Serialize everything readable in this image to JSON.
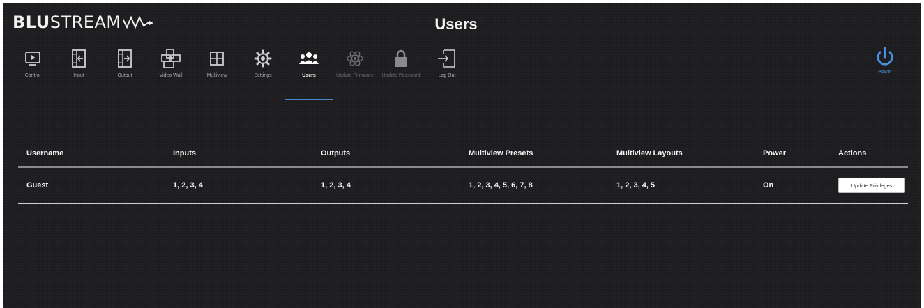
{
  "app": {
    "logo_bold": "BLU",
    "logo_rest": "STREAM"
  },
  "header": {
    "title": "Users"
  },
  "nav": {
    "items": [
      {
        "label": "Control",
        "icon": "control-icon"
      },
      {
        "label": "Input",
        "icon": "input-icon"
      },
      {
        "label": "Output",
        "icon": "output-icon"
      },
      {
        "label": "Video Wall",
        "icon": "video-wall-icon"
      },
      {
        "label": "Multiview",
        "icon": "multiview-icon"
      },
      {
        "label": "Settings",
        "icon": "gear-icon"
      },
      {
        "label": "Users",
        "icon": "users-icon",
        "active": true
      },
      {
        "label": "Update Firmware",
        "icon": "atom-icon",
        "disabled": true
      },
      {
        "label": "Update Password",
        "icon": "lock-icon",
        "disabled": true
      },
      {
        "label": "Log Out",
        "icon": "logout-icon"
      }
    ],
    "power_label": "Power"
  },
  "table": {
    "headers": {
      "username": "Username",
      "inputs": "Inputs",
      "outputs": "Outputs",
      "multiview_presets": "Multiview Presets",
      "multiview_layouts": "Multiview Layouts",
      "power": "Power",
      "actions": "Actions"
    },
    "rows": [
      {
        "username": "Guest",
        "inputs": "1, 2, 3, 4",
        "outputs": "1, 2, 3, 4",
        "multiview_presets": "1, 2, 3, 4, 5, 6, 7, 8",
        "multiview_layouts": "1, 2, 3, 4, 5",
        "power": "On",
        "action_label": "Update Privileges"
      }
    ]
  },
  "colors": {
    "background": "#1d1d1f",
    "accent": "#4a90e2",
    "active_underline": "#4f86c6",
    "text": "#f4f4f4",
    "muted": "#a9a9ad"
  }
}
